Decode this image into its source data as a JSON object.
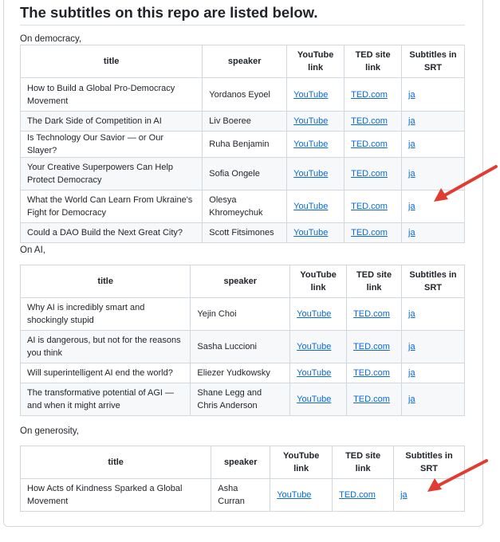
{
  "heading": "The subtitles on this repo are listed below.",
  "columns": {
    "title": "title",
    "speaker": "speaker",
    "youtube": "YouTube link",
    "ted": "TED site link",
    "subs": "Subtitles in SRT"
  },
  "sections": [
    {
      "label": "On democracy,",
      "rows": [
        {
          "title": "How to Build a Global Pro-Democracy Movement",
          "speaker": "Yordanos Eyoel",
          "youtube": "YouTube",
          "ted": "TED.com",
          "subs": "ja"
        },
        {
          "title": "The Dark Side of Competition in AI",
          "speaker": "Liv Boeree",
          "youtube": "YouTube",
          "ted": "TED.com",
          "subs": "ja"
        },
        {
          "title": "Is Technology Our Savior — or Our Slayer?",
          "speaker": "Ruha Benjamin",
          "youtube": "YouTube",
          "ted": "TED.com",
          "subs": "ja"
        },
        {
          "title": "Your Creative Superpowers Can Help Protect Democracy",
          "speaker": "Sofia Ongele",
          "youtube": "YouTube",
          "ted": "TED.com",
          "subs": "ja"
        },
        {
          "title": "What the World Can Learn From Ukraine's Fight for Democracy",
          "speaker": "Olesya Khromeychuk",
          "youtube": "YouTube",
          "ted": "TED.com",
          "subs": "ja"
        },
        {
          "title": "Could a DAO Build the Next Great City?",
          "speaker": "Scott Fitsimones",
          "youtube": "YouTube",
          "ted": "TED.com",
          "subs": "ja"
        }
      ]
    },
    {
      "label": "On AI,",
      "rows": [
        {
          "title": "Why AI is incredibly smart and shockingly stupid",
          "speaker": "Yejin Choi",
          "youtube": "YouTube",
          "ted": "TED.com",
          "subs": "ja"
        },
        {
          "title": "AI is dangerous, but not for the reasons you think",
          "speaker": "Sasha Luccioni",
          "youtube": "YouTube",
          "ted": "TED.com",
          "subs": "ja"
        },
        {
          "title": "Will superintelligent AI end the world?",
          "speaker": "Eliezer Yudkowsky",
          "youtube": "YouTube",
          "ted": "TED.com",
          "subs": "ja"
        },
        {
          "title": "The transformative potential of AGI — and when it might arrive",
          "speaker": "Shane Legg and Chris Anderson",
          "youtube": "YouTube",
          "ted": "TED.com",
          "subs": "ja"
        }
      ]
    },
    {
      "label": "On generosity,",
      "rows": [
        {
          "title": "How Acts of Kindness Sparked a Global Movement",
          "speaker": "Asha Curran",
          "youtube": "YouTube",
          "ted": "TED.com",
          "subs": "ja"
        }
      ]
    }
  ],
  "colors": {
    "link": "#0969da",
    "arrow": "#e03c31",
    "border": "#d0d7de",
    "stripe": "#f6f8fa"
  }
}
